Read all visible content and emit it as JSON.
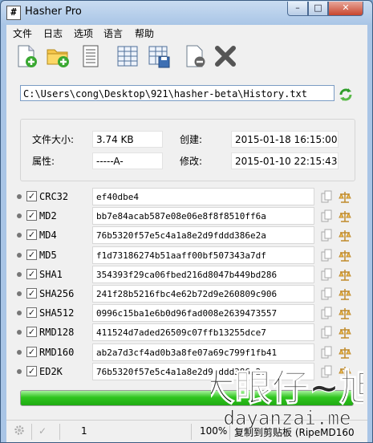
{
  "window": {
    "title": "Hasher Pro",
    "icon_glyph": "#",
    "minimize_glyph": "–",
    "maximize_glyph": "□",
    "close_glyph": "✕"
  },
  "menu": [
    "文件",
    "日志",
    "选项",
    "语言",
    "帮助"
  ],
  "toolbar_icons": [
    "add-file-icon",
    "add-folder-icon",
    "document-icon",
    "grid-view-icon",
    "grid-save-icon",
    "remove-file-icon",
    "clear-all-icon"
  ],
  "path": "C:\\Users\\cong\\Desktop\\921\\hasher-beta\\History.txt",
  "info": {
    "size_label": "文件大小:",
    "size_value": "3.74 KB",
    "attr_label": "属性:",
    "attr_value": "-----A-",
    "created_label": "创建:",
    "created_value": "2015-01-18 16:15:00",
    "modified_label": "修改:",
    "modified_value": "2015-01-10 22:15:43"
  },
  "hashes": [
    {
      "name": "CRC32",
      "value": "ef40dbe4",
      "checked": true
    },
    {
      "name": "MD2",
      "value": "bb7e84acab587e08e06e8f8f8510ff6a",
      "checked": true
    },
    {
      "name": "MD4",
      "value": "76b5320f57e5c4a1a8e2d9fddd386e2a",
      "checked": true
    },
    {
      "name": "MD5",
      "value": "f1d73186274b51aaff00bf507343a7df",
      "checked": true
    },
    {
      "name": "SHA1",
      "value": "354393f29ca06fbed216d8047b449bd286",
      "checked": true
    },
    {
      "name": "SHA256",
      "value": "241f28b5216fbc4e62b72d9e260809c906",
      "checked": true
    },
    {
      "name": "SHA512",
      "value": "0996c15ba1e6b0d96fad008e2639473557",
      "checked": true
    },
    {
      "name": "RMD128",
      "value": "411524d7aded26509c07ffb13255dce7",
      "checked": true
    },
    {
      "name": "RMD160",
      "value": "ab2a7d3cf4ad0b3a8fe07a69c799f1fb41",
      "checked": true
    },
    {
      "name": "ED2K",
      "value": "76b5320f57e5c4a1a8e2d9fddd386e2a",
      "checked": true
    }
  ],
  "check_glyph": "✓",
  "progress": {
    "fraction": 1.0
  },
  "status": {
    "count": "1",
    "zoom": "100%",
    "message": "复制到剪贴板 (RipeMD160"
  },
  "watermark": {
    "line1": "大眼仔~旭",
    "line2": "dayanzai.me"
  },
  "colors": {
    "progress": "#2fc51e",
    "titlebar": "#a9c5e6",
    "close": "#c7452d"
  }
}
